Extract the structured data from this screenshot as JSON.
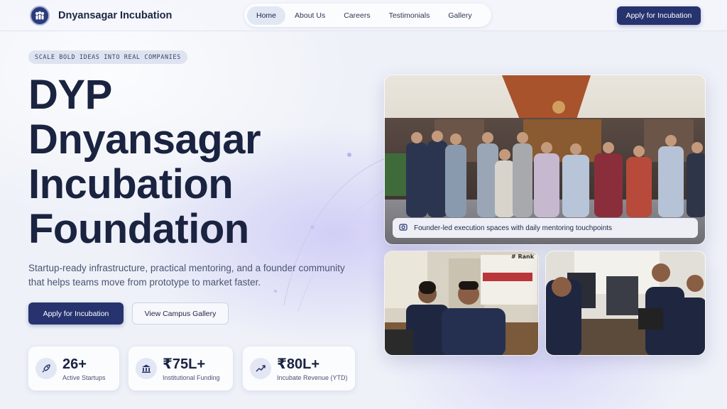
{
  "header": {
    "brand": "Dnyansagar Incubation",
    "nav": [
      {
        "label": "Home",
        "active": true
      },
      {
        "label": "About Us",
        "active": false
      },
      {
        "label": "Careers",
        "active": false
      },
      {
        "label": "Testimonials",
        "active": false
      },
      {
        "label": "Gallery",
        "active": false
      }
    ],
    "cta_label": "Apply for Incubation"
  },
  "hero": {
    "eyebrow": "SCALE BOLD IDEAS INTO REAL COMPANIES",
    "title_lines": [
      "DYP",
      "Dnyansagar",
      "Incubation",
      "Foundation"
    ],
    "description": "Startup-ready infrastructure, practical mentoring, and a founder community that helps teams move from prototype to market faster.",
    "primary_button": "Apply for Incubation",
    "secondary_button": "View Campus Gallery"
  },
  "stats": [
    {
      "icon": "rocket-icon",
      "value": "26+",
      "label": "Active Startups"
    },
    {
      "icon": "bank-icon",
      "value": "₹75L+",
      "label": "Institutional Funding"
    },
    {
      "icon": "trending-up-icon",
      "value": "₹80L+",
      "label": "Incubate Revenue (YTD)"
    }
  ],
  "gallery": {
    "caption": "Founder-led execution spaces with daily mentoring touchpoints",
    "photo_text": [
      "# Rank"
    ]
  },
  "colors": {
    "primary": "#26336f",
    "text_dark": "#1a2340",
    "background": "#eef1f8"
  }
}
